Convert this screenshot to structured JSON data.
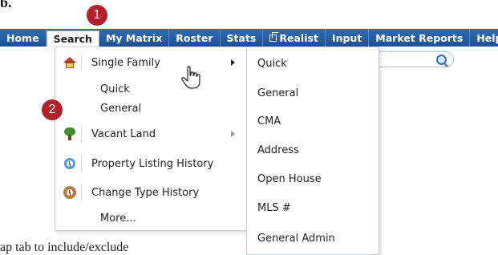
{
  "heading_fragment": "b.",
  "caption_fragment": "ap tab to include/exclude",
  "nav": {
    "items": [
      {
        "label": "Home"
      },
      {
        "label": "Search"
      },
      {
        "label": "My Matrix"
      },
      {
        "label": "Roster"
      },
      {
        "label": "Stats"
      },
      {
        "label": "Realist"
      },
      {
        "label": "Input"
      },
      {
        "label": "Market Reports"
      },
      {
        "label": "Help"
      }
    ],
    "active": "Search"
  },
  "search_menu": {
    "items": [
      {
        "label": "Single Family",
        "icon": "house-icon",
        "has_submenu": true
      },
      {
        "label": "Vacant Land",
        "icon": "tree-icon",
        "has_submenu": true
      },
      {
        "label": "Property Listing History",
        "icon": "history-clock-icon",
        "has_submenu": false
      },
      {
        "label": "Change Type History",
        "icon": "change-history-clock-icon",
        "has_submenu": false
      },
      {
        "label": "More...",
        "icon": "",
        "has_submenu": false
      }
    ],
    "inline_subitems": [
      "Quick",
      "General"
    ]
  },
  "single_family_submenu": {
    "items": [
      "Quick",
      "General",
      "CMA",
      "Address",
      "Open House",
      "MLS #",
      "General Admin"
    ]
  },
  "badges": [
    "1",
    "2"
  ],
  "colors": {
    "nav_bar": "#2461a8",
    "badge": "#b3202a",
    "menu_border": "#c9ced6"
  }
}
